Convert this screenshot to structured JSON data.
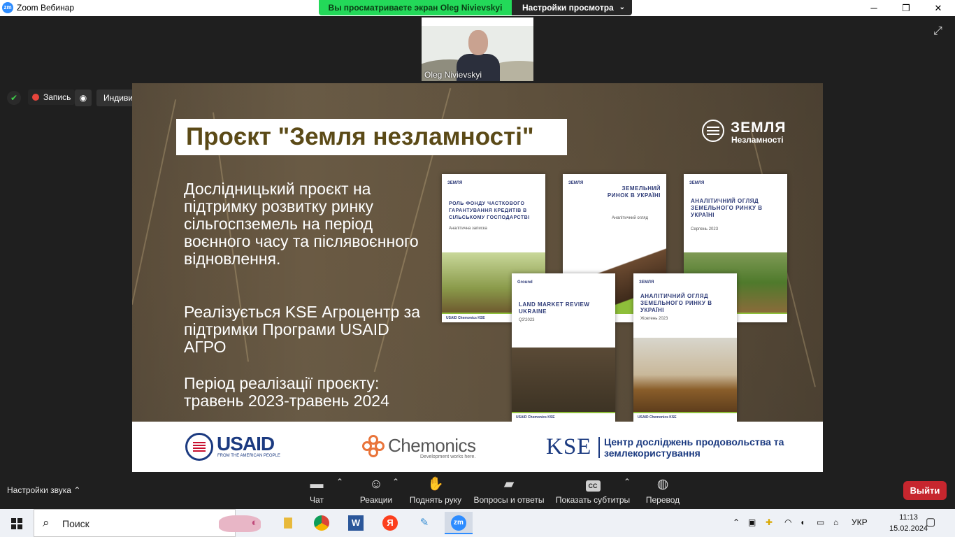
{
  "window": {
    "title": "Zoom Вебинар",
    "app_icon": "zm",
    "minimize": "─",
    "maximize": "❐",
    "close": "✕"
  },
  "share": {
    "banner": "Вы просматриваете экран Oleg Nivievskyi",
    "view_settings": "Настройки просмотра",
    "chevron": "⌄"
  },
  "participant": {
    "name": "Oleg Nivievskyi"
  },
  "top_controls": {
    "record_label": "Запись",
    "stream_label": "Индивидуальная служба потокового вещания",
    "chevron": "▾"
  },
  "slide": {
    "title": "Проєкт \"Земля незламності\"",
    "brand_line1": "ЗЕМЛЯ",
    "brand_line2": "Незламності",
    "paragraph1": "Дослідницький проєкт на підтримку розвитку ринку сільгоспземель на період воєнного часу та післявоєнного відновлення.",
    "paragraph2": "Реалізується KSE Агроцентр за підтримки Програми USAID АГРО",
    "paragraph3": "Період реалізації проєкту: травень 2023-травень 2024",
    "reports": [
      {
        "head": "ЗЕМЛЯ",
        "title": "РОЛЬ ФОНДУ ЧАСТКОВОГО ГАРАНТУВАННЯ КРЕДИТІВ В СІЛЬСЬКОМУ ГОСПОДАРСТВІ",
        "sub": "Аналітична записка"
      },
      {
        "head": "ЗЕМЛЯ",
        "title": "ЗЕМЕЛЬНИЙ РИНОК В УКРАЇНІ",
        "sub": "Аналітичний огляд"
      },
      {
        "head": "ЗЕМЛЯ",
        "title": "АНАЛІТИЧНИЙ ОГЛЯД ЗЕМЕЛЬНОГО РИНКУ В УКРАЇНІ",
        "sub": "Серпень 2023"
      },
      {
        "head": "Ground",
        "title": "LAND MARKET REVIEW UKRAINE",
        "sub": "Q3'2023"
      },
      {
        "head": "ЗЕМЛЯ",
        "title": "АНАЛІТИЧНИЙ ОГЛЯД ЗЕМЕЛЬНОГО РИНКУ В УКРАЇНІ",
        "sub": "Жовтень 2023"
      }
    ],
    "report_footer": "USAID   Chemonics   KSE",
    "logos": {
      "usaid": "USAID",
      "usaid_sub": "FROM THE AMERICAN PEOPLE",
      "chemonics": "Chemonics",
      "chemonics_sub": "Development works here.",
      "kse": "KSE",
      "kse_text": "Центр досліджень продовольства та землекористування"
    }
  },
  "toolbar": {
    "sound": "Настройки звука",
    "caret": "⌃",
    "items": [
      {
        "label": "Чат",
        "icon": "chat-icon"
      },
      {
        "label": "Реакции",
        "icon": "reaction-icon"
      },
      {
        "label": "Поднять руку",
        "icon": "hand-icon"
      },
      {
        "label": "Вопросы и ответы",
        "icon": "qa-icon"
      },
      {
        "label": "Показать субтитры",
        "icon": "cc-icon",
        "glyph": "CC"
      },
      {
        "label": "Перевод",
        "icon": "globe-icon"
      }
    ],
    "leave": "Выйти"
  },
  "taskbar": {
    "search": "Поиск",
    "apps": [
      "paint-icon",
      "explorer-icon",
      "chrome-icon",
      "word-icon",
      "yandex-icon",
      "paint3d-icon",
      "zoom-icon"
    ],
    "word_glyph": "W",
    "yandex_glyph": "Я",
    "zoom_glyph": "zm",
    "lang": "УКР",
    "time": "11:13",
    "date": "15.02.2024"
  },
  "colors": {
    "accent": "#2d8cff",
    "share_green": "#23d959",
    "leave_red": "#c6262e",
    "title_brown": "#5b4a17",
    "report_blue": "#2f3c78",
    "usaid_blue": "#1b3a80",
    "chem_orange": "#e9743a"
  }
}
